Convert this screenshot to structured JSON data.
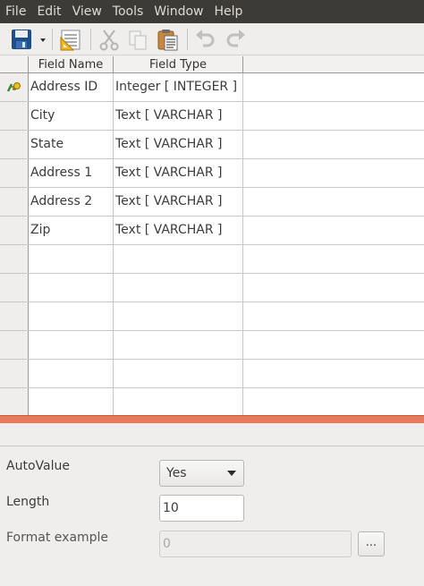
{
  "menu": [
    "File",
    "Edit",
    "View",
    "Tools",
    "Window",
    "Help"
  ],
  "toolbar": {
    "icons": [
      "save-icon",
      "dropdown-arrow-icon",
      "table-design-icon",
      "cut-icon",
      "copy-icon",
      "paste-icon",
      "undo-icon",
      "redo-icon"
    ]
  },
  "table": {
    "columns": [
      "Field Name",
      "Field Type"
    ],
    "rows": [
      {
        "name": "Address ID",
        "type": "Integer [ INTEGER ]",
        "primary_key": true
      },
      {
        "name": "City",
        "type": "Text [ VARCHAR ]"
      },
      {
        "name": "State",
        "type": "Text [ VARCHAR ]"
      },
      {
        "name": "Address 1",
        "type": "Text [ VARCHAR ]"
      },
      {
        "name": "Address 2",
        "type": "Text [ VARCHAR ]"
      },
      {
        "name": "Zip",
        "type": "Text [ VARCHAR ]"
      }
    ],
    "empty_rows": 6
  },
  "properties": {
    "autovalue_label": "AutoValue",
    "autovalue_value": "Yes",
    "length_label": "Length",
    "length_value": "10",
    "format_label": "Format example",
    "format_value": "0",
    "format_button": "..."
  },
  "colors": {
    "menubar": "#3c3b37",
    "splitter": "#e9795b"
  }
}
